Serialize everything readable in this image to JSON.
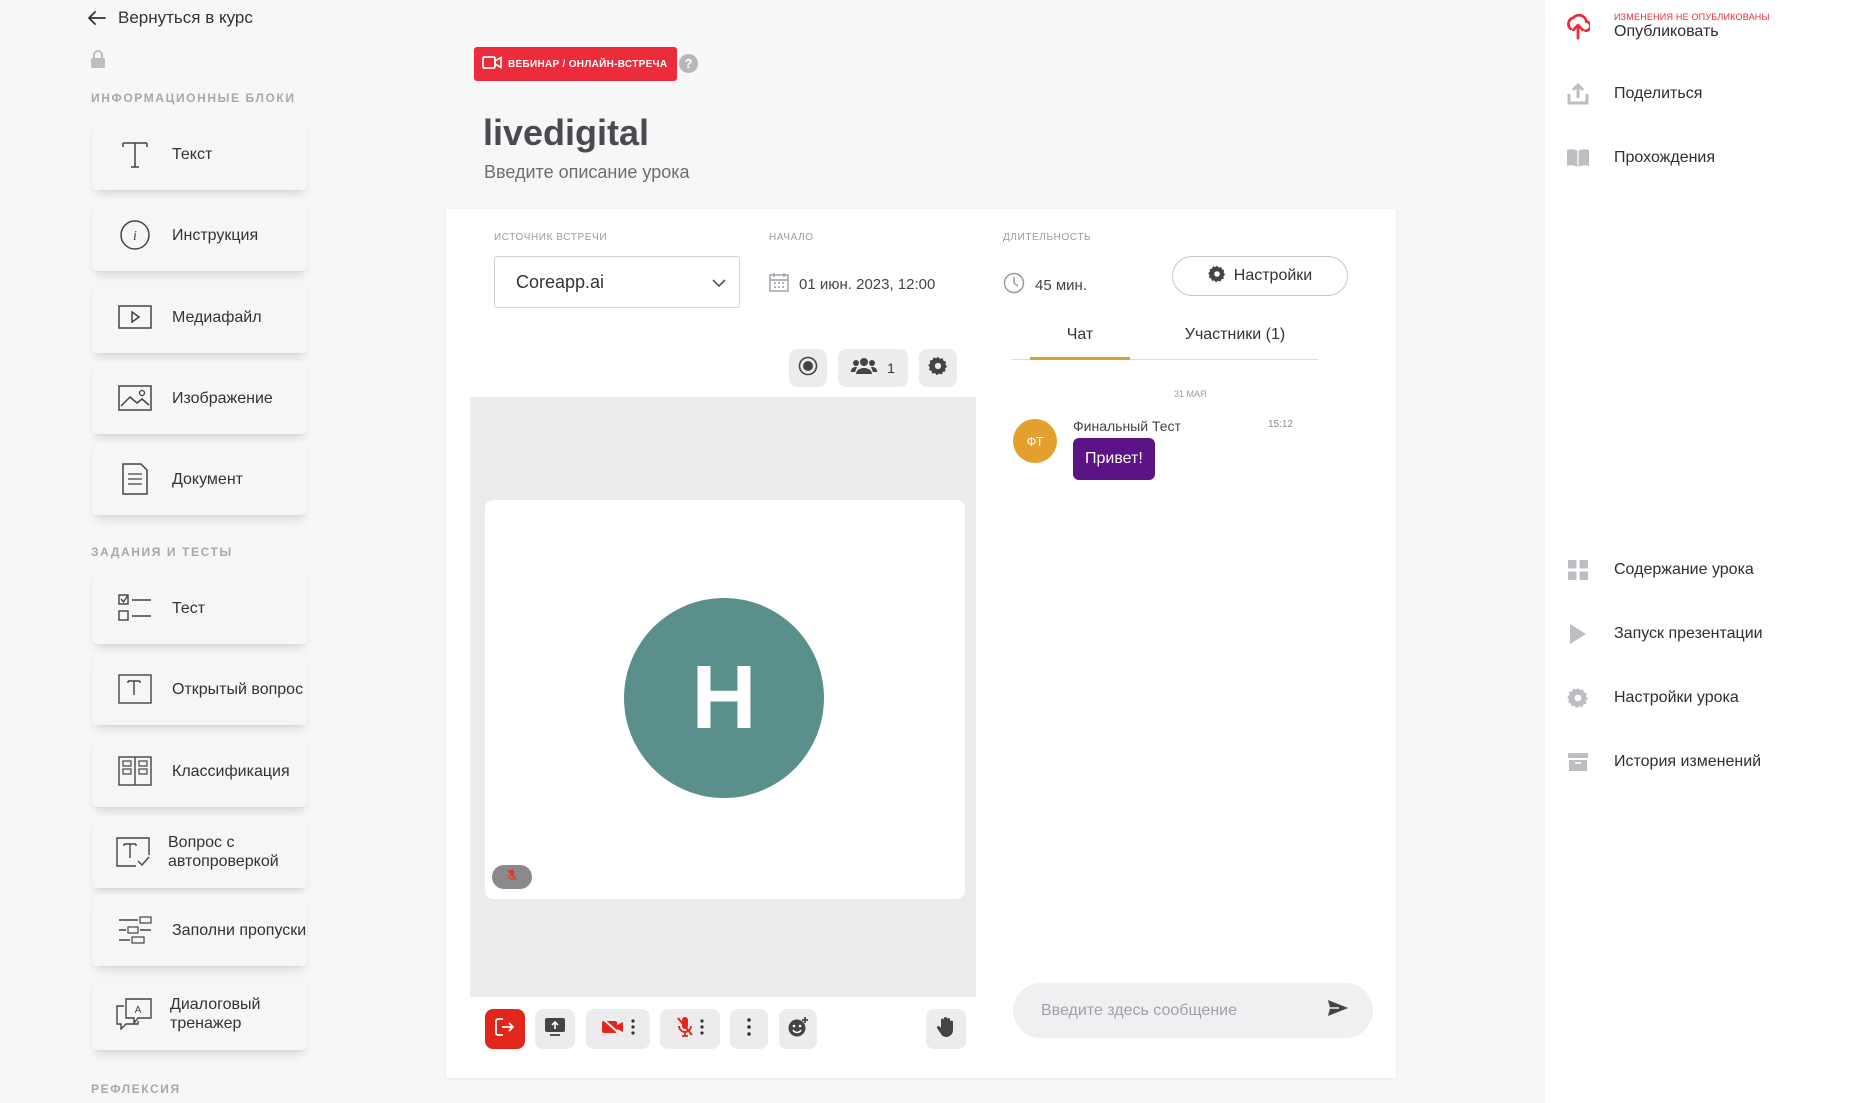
{
  "nav": {
    "back_label": "Вернуться в курс"
  },
  "sidebar": {
    "info_section_title": "Информационные блоки",
    "info_blocks": [
      {
        "label": "Текст",
        "icon": "text-icon"
      },
      {
        "label": "Инструкция",
        "icon": "info-icon"
      },
      {
        "label": "Медиафайл",
        "icon": "media-icon"
      },
      {
        "label": "Изображение",
        "icon": "image-icon"
      },
      {
        "label": "Документ",
        "icon": "document-icon"
      }
    ],
    "tasks_section_title": "Задания и тесты",
    "task_blocks": [
      {
        "label": "Тест",
        "icon": "checklist-icon"
      },
      {
        "label": "Открытый вопрос",
        "icon": "open-question-icon"
      },
      {
        "label": "Классификация",
        "icon": "classification-icon"
      },
      {
        "label": "Вопрос с автопроверкой",
        "icon": "autocheck-icon"
      },
      {
        "label": "Заполни пропуски",
        "icon": "fill-gaps-icon"
      },
      {
        "label": "Диалоговый тренажер",
        "icon": "dialog-icon"
      }
    ],
    "reflection_section_title": "Рефлексия"
  },
  "header": {
    "badge": "ВЕБИНАР / ОНЛАЙН-ВСТРЕЧА",
    "help": "?",
    "title": "livedigital",
    "description": "Введите описание урока"
  },
  "meeting": {
    "source_label": "Источник встречи",
    "source_value": "Coreapp.ai",
    "start_label": "Начало",
    "start_value": "01 июн. 2023, 12:00",
    "duration_label": "Длительность",
    "duration_value": "45 мин.",
    "settings_button": "Настройки"
  },
  "video": {
    "participants_count": "1",
    "avatar_letter": "H"
  },
  "chat": {
    "tabs": [
      "Чат",
      "Участники (1)"
    ],
    "active_tab": 0,
    "date": "31 МАЯ",
    "message": {
      "initials": "ФТ",
      "author": "Финальный Тест",
      "time": "15:12",
      "text": "Привет!"
    },
    "input_placeholder": "Введите здесь сообщение"
  },
  "right_panel": {
    "publish_note": "ИЗМЕНЕНИЯ НЕ ОПУБЛИКОВАНЫ",
    "publish_label": "Опубликовать",
    "share_label": "Поделиться",
    "passes_label": "Прохождения",
    "contents_label": "Содержание урока",
    "presentation_label": "Запуск презентации",
    "lesson_settings_label": "Настройки урока",
    "history_label": "История изменений"
  },
  "colors": {
    "accent_red": "#ec2c3b",
    "tab_underline": "#e3a02c",
    "bubble": "#5b1386",
    "avatar_big": "#5a8f8c"
  }
}
